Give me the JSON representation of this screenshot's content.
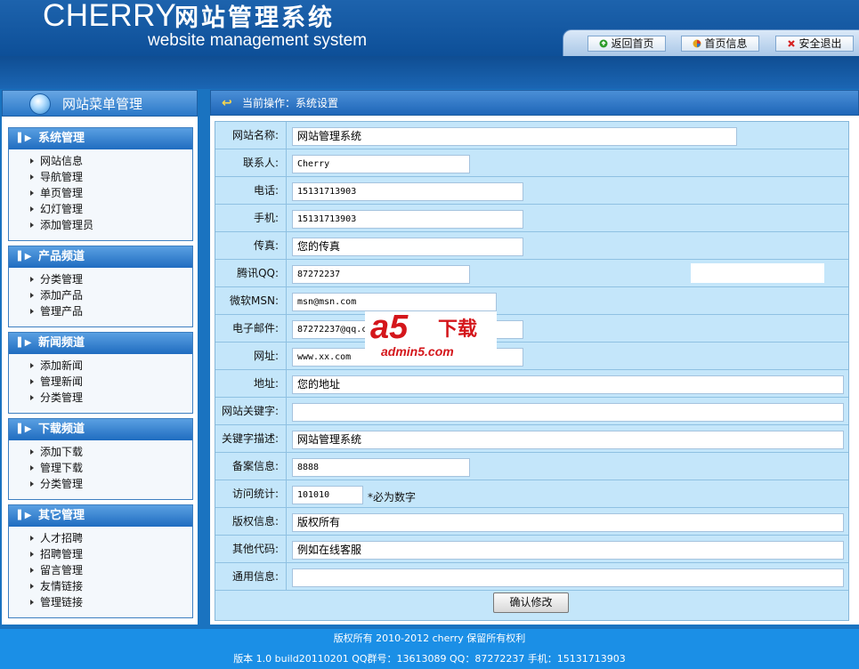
{
  "header": {
    "logo_en": "CHERRY",
    "logo_cn": "网站管理系统",
    "logo_sub": "website management system",
    "nav": [
      {
        "label": "返回首页",
        "icon": "home-icon"
      },
      {
        "label": "首页信息",
        "icon": "info-icon"
      },
      {
        "label": "安全退出",
        "icon": "logout-icon"
      }
    ]
  },
  "sidebar": {
    "title": "网站菜单管理",
    "groups": [
      {
        "title": "系统管理",
        "items": [
          "网站信息",
          "导航管理",
          "单页管理",
          "幻灯管理",
          "添加管理员"
        ]
      },
      {
        "title": "产品频道",
        "items": [
          "分类管理",
          "添加产品",
          "管理产品"
        ]
      },
      {
        "title": "新闻频道",
        "items": [
          "添加新闻",
          "管理新闻",
          "分类管理"
        ]
      },
      {
        "title": "下载频道",
        "items": [
          "添加下载",
          "管理下载",
          "分类管理"
        ]
      },
      {
        "title": "其它管理",
        "items": [
          "人才招聘",
          "招聘管理",
          "留言管理",
          "友情链接",
          "管理链接"
        ]
      }
    ]
  },
  "main": {
    "breadcrumb": "当前操作：系统设置",
    "fields": [
      {
        "label": "网站名称:",
        "value": "网站管理系统"
      },
      {
        "label": "联系人:",
        "value": "Cherry"
      },
      {
        "label": "电话:",
        "value": "15131713903"
      },
      {
        "label": "手机:",
        "value": "15131713903"
      },
      {
        "label": "传真:",
        "value": "您的传真"
      },
      {
        "label": "腾讯QQ:",
        "value": "87272237"
      },
      {
        "label": "微软MSN:",
        "value": "msn@msn.com"
      },
      {
        "label": "电子邮件:",
        "value": "87272237@qq.c"
      },
      {
        "label": "网址:",
        "value": "www.xx.com"
      },
      {
        "label": "地址:",
        "value": "您的地址"
      },
      {
        "label": "网站关键字:",
        "value": ""
      },
      {
        "label": "关键字描述:",
        "value": "网站管理系统"
      },
      {
        "label": "备案信息:",
        "value": "8888"
      },
      {
        "label": "访问统计:",
        "value": "101010"
      },
      {
        "label": "版权信息:",
        "value": "版权所有"
      },
      {
        "label": "其他代码:",
        "value": "例如在线客服"
      },
      {
        "label": "通用信息:",
        "value": ""
      }
    ],
    "stats_note": "*必为数字",
    "submit_label": "确认修改"
  },
  "watermark": {
    "brand": "a5",
    "text": "下载",
    "url": "admin5.com"
  },
  "footer": {
    "line1": "版权所有 2010-2012 cherry 保留所有权利",
    "line2": "版本 1.0 build20110201 QQ群号：13613089 QQ：87272237 手机：15131713903"
  }
}
